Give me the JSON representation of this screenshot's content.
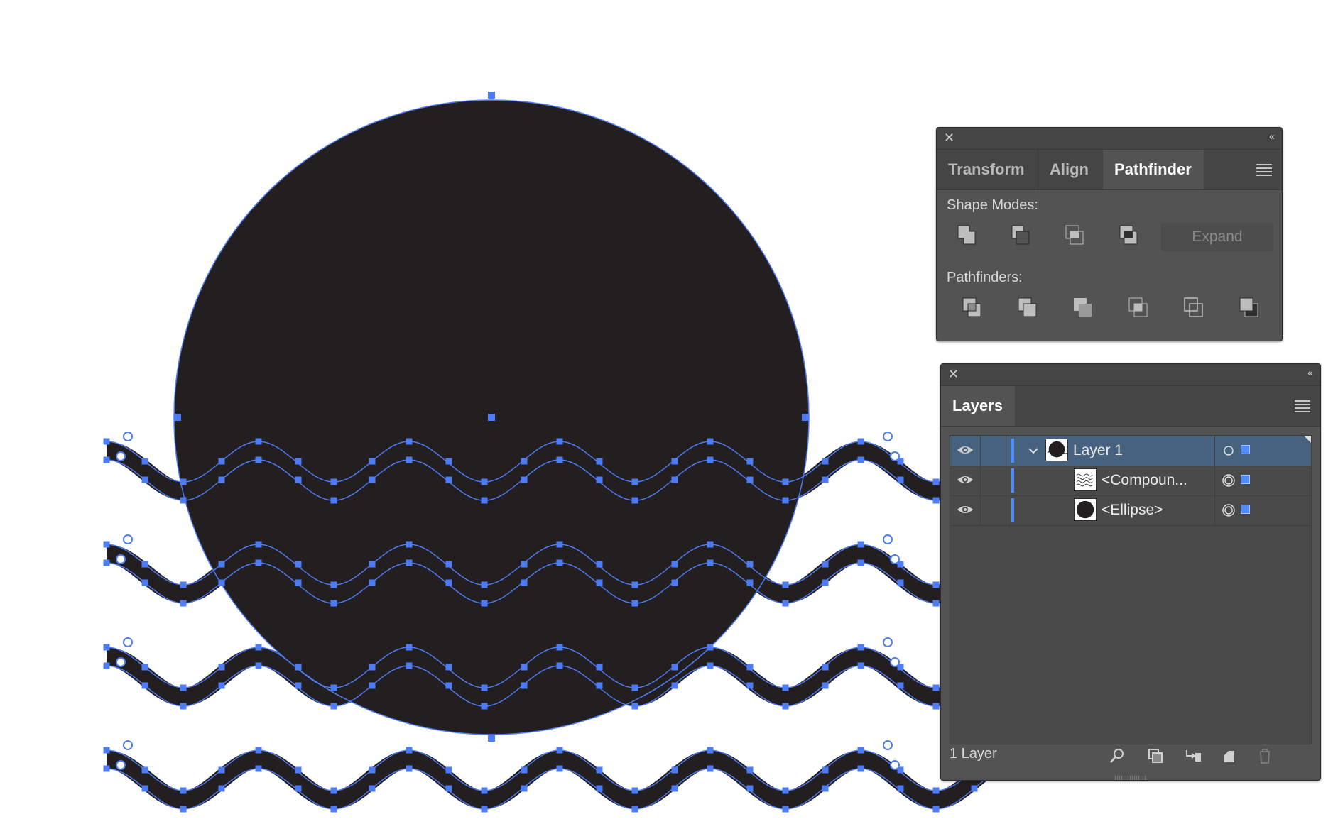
{
  "pathfinder_panel": {
    "tabs": [
      "Transform",
      "Align",
      "Pathfinder"
    ],
    "active_tab": "Pathfinder",
    "shape_modes_label": "Shape Modes:",
    "shape_mode_buttons": [
      "unite-icon",
      "minus-front-icon",
      "intersect-icon",
      "exclude-icon"
    ],
    "expand_label": "Expand",
    "pathfinders_label": "Pathfinders:",
    "pathfinder_buttons": [
      "divide-icon",
      "trim-icon",
      "merge-icon",
      "crop-icon",
      "outline-icon",
      "minus-back-icon"
    ]
  },
  "layers_panel": {
    "title": "Layers",
    "rows": [
      {
        "name": "Layer 1",
        "thumbnail": "circle-waves",
        "selected": true,
        "expanded": true
      },
      {
        "name": "<Compoun...",
        "thumbnail": "waves",
        "selected": false
      },
      {
        "name": "<Ellipse>",
        "thumbnail": "circle",
        "selected": false
      }
    ],
    "footer_count": "1 Layer",
    "footer_icons": [
      "locate-object-icon",
      "make-clipping-mask-icon",
      "create-sublayer-icon",
      "new-layer-icon",
      "delete-icon"
    ]
  },
  "colors": {
    "artwork_fill": "#231f20",
    "selection": "#4e7cf6",
    "panel_bg": "#535353",
    "selected_row": "#46627e"
  }
}
